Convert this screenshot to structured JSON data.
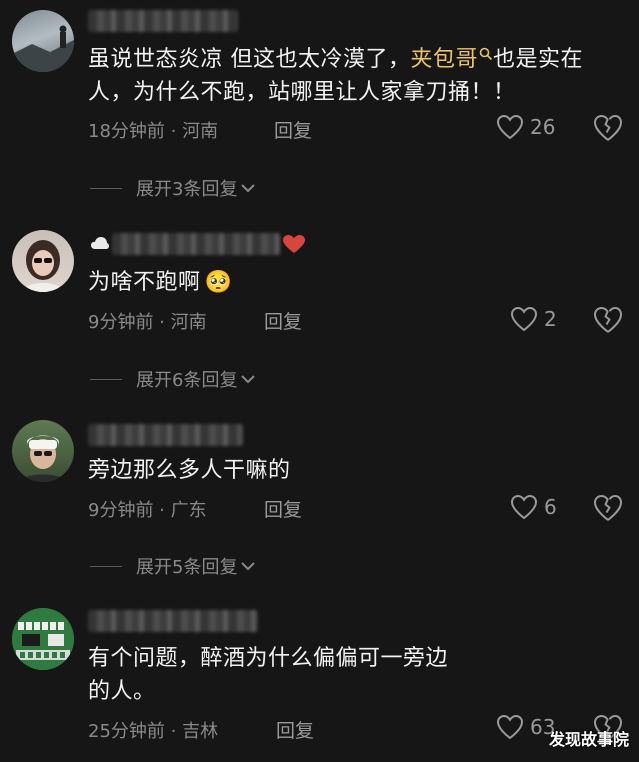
{
  "comments": [
    {
      "text_before": "虽说世态炎凉  但这也太冷漠了，",
      "highlight": "夹包哥",
      "text_after": "也是实在人，为什么不跑，站哪里让人家拿刀捅！！",
      "time": "18分钟前",
      "location": "河南",
      "reply_label": "回复",
      "likes": "26",
      "expand_label": "展开3条回复"
    },
    {
      "text": "为啥不跑啊",
      "emoji": "🥺",
      "time": "9分钟前",
      "location": "河南",
      "reply_label": "回复",
      "likes": "2",
      "expand_label": "展开6条回复"
    },
    {
      "text": "旁边那么多人干嘛的",
      "time": "9分钟前",
      "location": "广东",
      "reply_label": "回复",
      "likes": "6",
      "expand_label": "展开5条回复"
    },
    {
      "text": "有个问题，醉酒为什么偏偏可一旁边的人。",
      "time": "25分钟前",
      "location": "吉林",
      "reply_label": "回复",
      "likes": "63"
    }
  ],
  "icons": {
    "like": "heart-outline-icon",
    "dislike": "broken-heart-icon",
    "expand": "chevron-down-icon",
    "search": "search-icon"
  },
  "colors": {
    "background": "#161616",
    "highlight": "#e9c46a",
    "meta": "#8a8a8a"
  },
  "watermark": "发现故事院",
  "separator": " · "
}
